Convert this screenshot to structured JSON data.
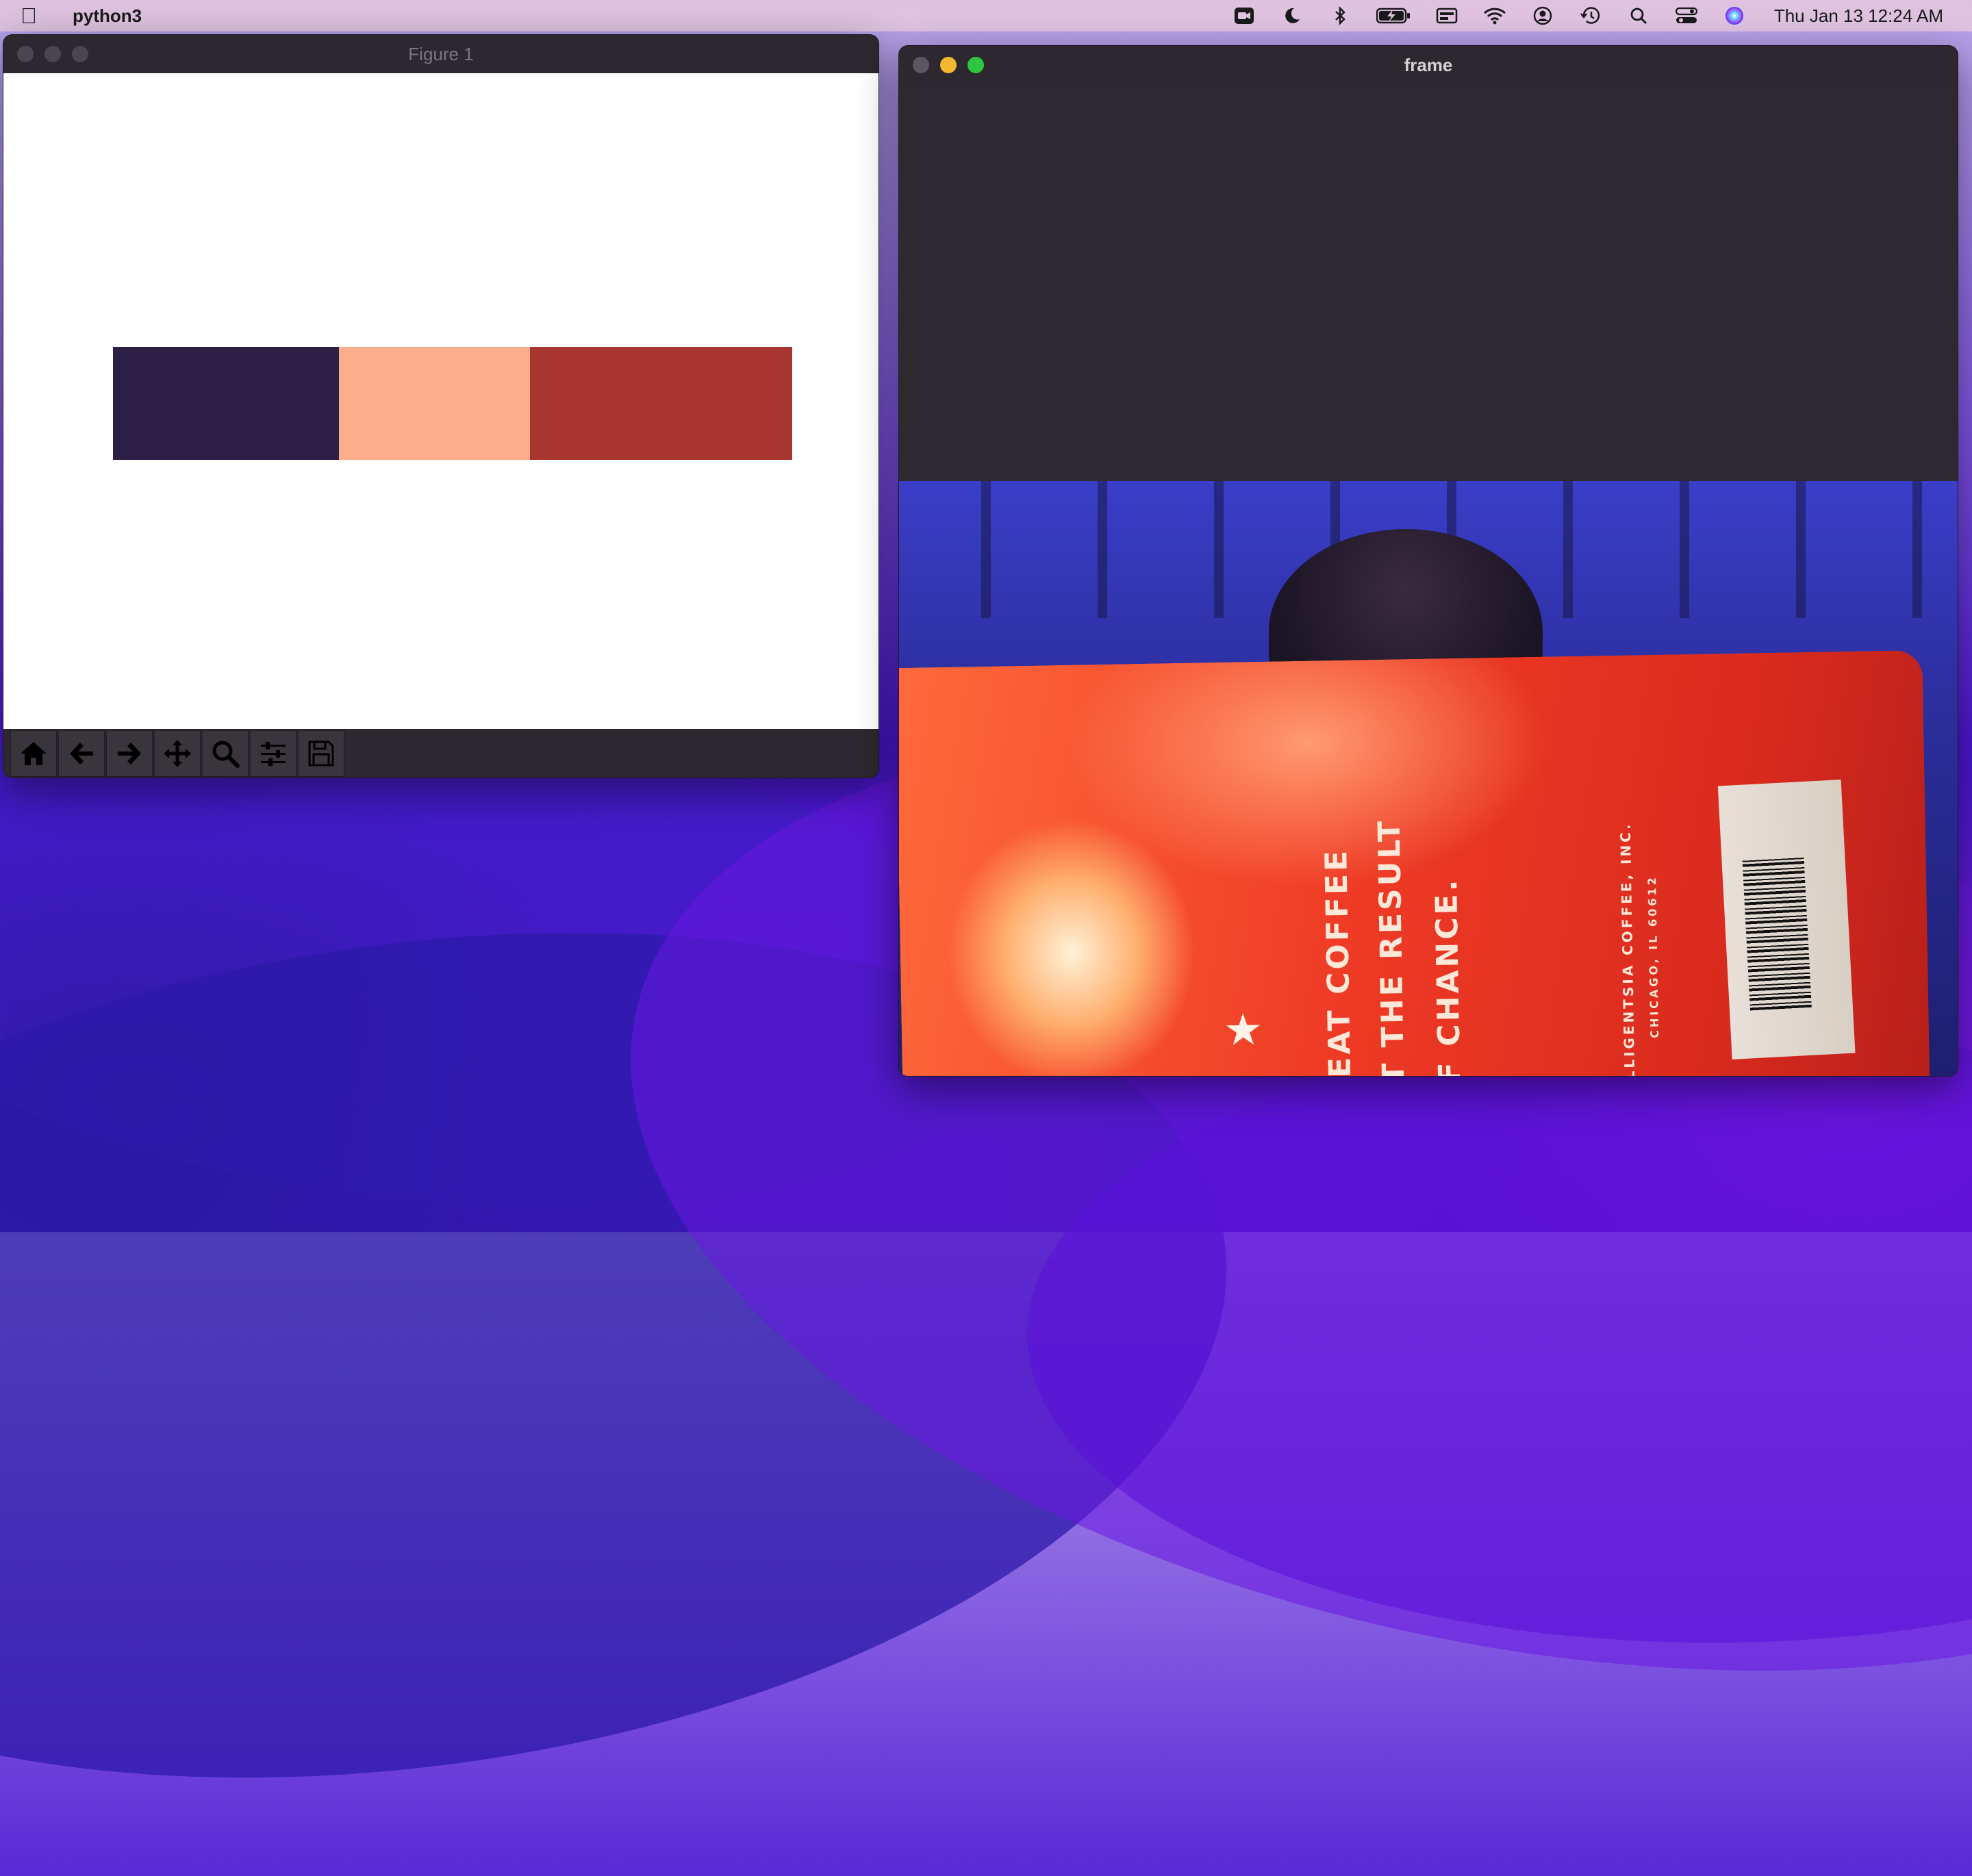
{
  "menubar": {
    "app_name": "python3",
    "clock": "Thu Jan 13  12:24 AM",
    "tray_icons": [
      "video-icon",
      "moon-icon",
      "bluetooth-icon",
      "battery-icon",
      "keyboard-icon",
      "wifi-icon",
      "user-icon",
      "time-machine-icon",
      "search-icon",
      "control-center-icon",
      "siri-icon"
    ]
  },
  "figure_window": {
    "title": "Figure 1",
    "swatches": [
      {
        "color": "#2d2047",
        "fraction": 0.333
      },
      {
        "color": "#fcae8c",
        "fraction": 0.281
      },
      {
        "color": "#a83630",
        "fraction": 0.386
      }
    ],
    "toolbar": [
      "home-icon",
      "back-icon",
      "forward-icon",
      "pan-icon",
      "zoom-icon",
      "configure-icon",
      "save-icon"
    ]
  },
  "frame_window": {
    "title": "frame",
    "bag_text": {
      "line1": "EAT COFFEE",
      "line2": "T THE RESULT",
      "line3": "F CHANCE.",
      "company": "LLIGENTSIA COFFEE, INC.",
      "city": "CHICAGO, IL 60612"
    }
  }
}
